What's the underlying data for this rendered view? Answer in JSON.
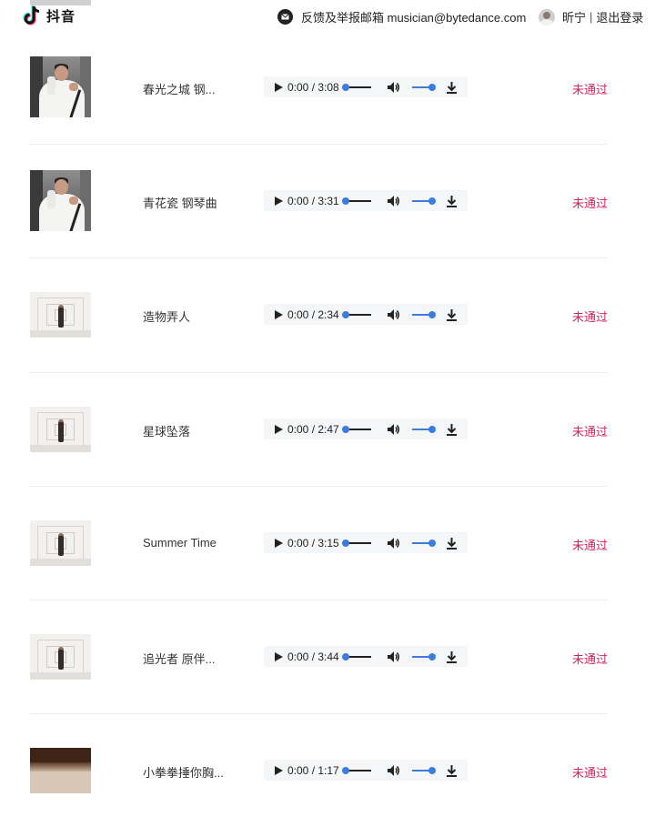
{
  "header": {
    "logo_text": "抖音",
    "feedback_text": "反馈及举报邮箱 musician@bytedance.com",
    "user_name": "昕宁",
    "separator": "|",
    "logout": "退出登录"
  },
  "colors": {
    "status": "#d6205f",
    "accent": "#3b7ddd"
  },
  "icons": {
    "play": "play-icon",
    "volume": "volume-icon",
    "download": "download-icon",
    "mail": "mail-icon",
    "logo": "tiktok-logo-icon"
  },
  "tracks": [
    {
      "title": "春光之城 钢...",
      "time": "0:00 / 3:08",
      "status": "未通过",
      "thumb": "portrait"
    },
    {
      "title": "青花瓷 钢琴曲",
      "time": "0:00 / 3:31",
      "status": "未通过",
      "thumb": "portrait"
    },
    {
      "title": "造物弄人",
      "time": "0:00 / 2:34",
      "status": "未通过",
      "thumb": "corridor"
    },
    {
      "title": "星球坠落",
      "time": "0:00 / 2:47",
      "status": "未通过",
      "thumb": "corridor"
    },
    {
      "title": "Summer Time",
      "time": "0:00 / 3:15",
      "status": "未通过",
      "thumb": "corridor"
    },
    {
      "title": "追光者 原伴...",
      "time": "0:00 / 3:44",
      "status": "未通过",
      "thumb": "corridor"
    },
    {
      "title": "小拳拳捶你胸...",
      "time": "0:00 / 1:17",
      "status": "未通过",
      "thumb": "warm"
    }
  ]
}
